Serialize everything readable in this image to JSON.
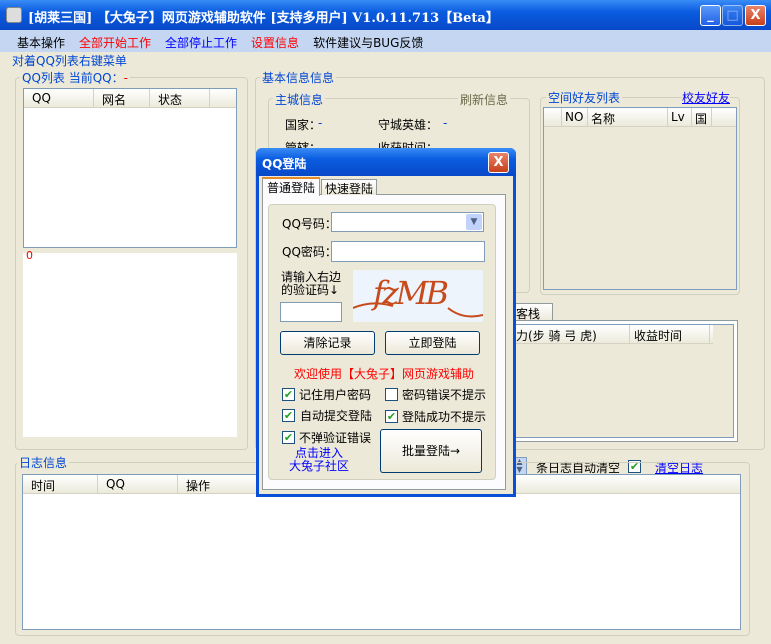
{
  "window": {
    "title": "[胡莱三国] 【大兔子】网页游戏辅助软件  [支持多用户] V1.0.11.713【Beta】",
    "minimize": "_",
    "maximize": "□",
    "close": "X"
  },
  "menu": [
    {
      "label": "基本操作",
      "color": "#000000"
    },
    {
      "label": "全部开始工作",
      "color": "#ff0000"
    },
    {
      "label": "全部停止工作",
      "color": "#0000ff"
    },
    {
      "label": "设置信息",
      "color": "#ff0000"
    },
    {
      "label": "软件建议与BUG反馈",
      "color": "#000000"
    }
  ],
  "hint": "对着QQ列表右键菜单",
  "qqlist": {
    "label": "QQ列表 当前QQ：",
    "current": "-",
    "columns": [
      "QQ",
      "网名",
      "状态"
    ],
    "count": "0"
  },
  "basic": {
    "label": "基本信息信息",
    "city": {
      "label": "主城信息",
      "refresh": "刷新信息",
      "country_label": "国家：",
      "country": "-",
      "hero_label": "守城英雄：",
      "hero": "-",
      "govern_label": "管辖：",
      "harvest_label": "收获时间："
    },
    "friends": {
      "label": "空间好友列表",
      "link": "校友好友",
      "columns": [
        "NO",
        "名称",
        "Lv",
        "国"
      ]
    },
    "tab": "客栈",
    "table_columns": [
      "兵力(步 骑 弓 虎)",
      "收益时间"
    ]
  },
  "logctl": {
    "suffix": "条日志自动清空",
    "clear": "清空日志",
    "auto_clear": true
  },
  "log": {
    "label": "日志信息",
    "columns": [
      "时间",
      "QQ",
      "操作"
    ]
  },
  "dialog": {
    "title": "QQ登陆",
    "close": "X",
    "tabs": [
      "普通登陆",
      "快速登陆"
    ],
    "qq_label": "QQ号码：",
    "qq_value": "",
    "pwd_label": "QQ密码：",
    "pwd_value": "",
    "captcha_label1": "请输入右边",
    "captcha_label2": "的验证码↓",
    "captcha_value": "",
    "captcha_text": "fzMB",
    "clear_btn": "清除记录",
    "login_btn": "立即登陆",
    "welcome": "欢迎使用【大兔子】网页游戏辅助",
    "options": [
      {
        "label": "记住用户密码",
        "checked": true
      },
      {
        "label": "密码错误不提示",
        "checked": false
      },
      {
        "label": "自动提交登陆",
        "checked": true
      },
      {
        "label": "登陆成功不提示",
        "checked": true
      },
      {
        "label": "不弹验证错误",
        "checked": true
      }
    ],
    "community1": "点击进入",
    "community2": "大兔子社区",
    "batch_btn": "批量登陆→"
  },
  "colors": {
    "accent": "#0046d5",
    "red": "#ff0000",
    "link": "#0000ff"
  }
}
